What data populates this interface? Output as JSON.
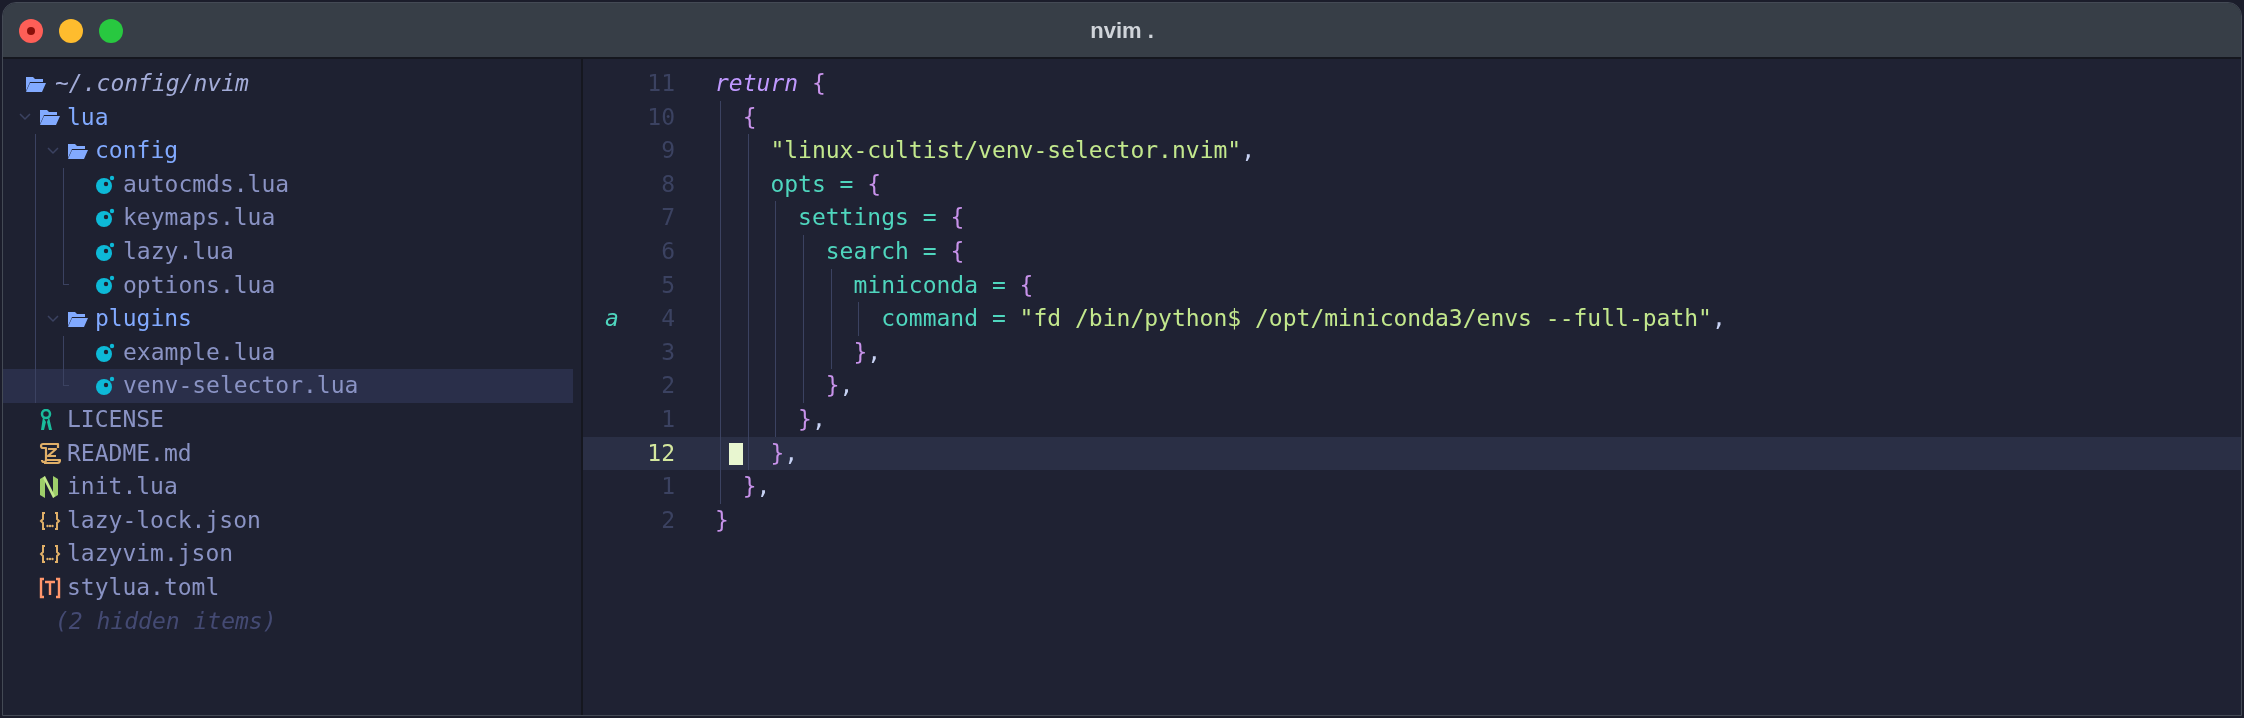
{
  "window": {
    "title": "nvim ."
  },
  "tree": {
    "root": "~/.config/nvim",
    "items": [
      {
        "kind": "folder",
        "name": "lua",
        "expanded": true,
        "selected": false,
        "children": [
          {
            "kind": "folder",
            "name": "config",
            "expanded": true,
            "selected": false,
            "children": [
              {
                "kind": "lua",
                "name": "autocmds.lua",
                "selected": false
              },
              {
                "kind": "lua",
                "name": "keymaps.lua",
                "selected": false
              },
              {
                "kind": "lua",
                "name": "lazy.lua",
                "selected": false
              },
              {
                "kind": "lua",
                "name": "options.lua",
                "selected": false
              }
            ]
          },
          {
            "kind": "folder",
            "name": "plugins",
            "expanded": true,
            "selected": false,
            "children": [
              {
                "kind": "lua",
                "name": "example.lua",
                "selected": false
              },
              {
                "kind": "lua",
                "name": "venv-selector.lua",
                "selected": true
              }
            ]
          }
        ]
      },
      {
        "kind": "license",
        "name": "LICENSE",
        "selected": false
      },
      {
        "kind": "markdown",
        "name": "README.md",
        "selected": false
      },
      {
        "kind": "neovim",
        "name": "init.lua",
        "selected": false
      },
      {
        "kind": "json",
        "name": "lazy-lock.json",
        "selected": false
      },
      {
        "kind": "json",
        "name": "lazyvim.json",
        "selected": false
      },
      {
        "kind": "toml",
        "name": "stylua.toml",
        "selected": false
      }
    ],
    "hidden_note": "(2 hidden items)"
  },
  "editor": {
    "lines": [
      {
        "number": "11",
        "current": false,
        "segments": [
          {
            "kind": "keyword",
            "text": "return"
          },
          {
            "kind": "punct",
            "text": " {"
          }
        ]
      },
      {
        "number": "10",
        "current": false,
        "segments": [
          {
            "kind": "punct",
            "text": "  {"
          }
        ]
      },
      {
        "number": "9",
        "current": false,
        "segments": [
          {
            "kind": "string",
            "text": "    \"linux-cultist/venv-selector.nvim\""
          },
          {
            "kind": "plain",
            "text": ","
          }
        ]
      },
      {
        "number": "8",
        "current": false,
        "segments": [
          {
            "kind": "field",
            "text": "    opts = "
          },
          {
            "kind": "punct",
            "text": "{"
          }
        ]
      },
      {
        "number": "7",
        "current": false,
        "segments": [
          {
            "kind": "field",
            "text": "      settings = "
          },
          {
            "kind": "punct",
            "text": "{"
          }
        ]
      },
      {
        "number": "6",
        "current": false,
        "segments": [
          {
            "kind": "field",
            "text": "        search = "
          },
          {
            "kind": "punct",
            "text": "{"
          }
        ]
      },
      {
        "number": "5",
        "current": false,
        "segments": [
          {
            "kind": "field",
            "text": "          miniconda = "
          },
          {
            "kind": "punct",
            "text": "{"
          }
        ]
      },
      {
        "number": "4",
        "sign": "a",
        "current": false,
        "segments": [
          {
            "kind": "field",
            "text": "            command = "
          },
          {
            "kind": "string",
            "text": "\"fd /bin/python$ /opt/miniconda3/envs --full-path\""
          },
          {
            "kind": "plain",
            "text": ","
          }
        ]
      },
      {
        "number": "3",
        "current": false,
        "segments": [
          {
            "kind": "punct",
            "text": "          }"
          },
          {
            "kind": "plain",
            "text": ","
          }
        ]
      },
      {
        "number": "2",
        "current": false,
        "segments": [
          {
            "kind": "punct",
            "text": "        }"
          },
          {
            "kind": "plain",
            "text": ","
          }
        ]
      },
      {
        "number": "1",
        "current": false,
        "segments": [
          {
            "kind": "punct",
            "text": "      }"
          },
          {
            "kind": "plain",
            "text": ","
          }
        ]
      },
      {
        "number": "12",
        "current": true,
        "segments": [
          {
            "kind": "punct",
            "text": "    }"
          },
          {
            "kind": "plain",
            "text": ","
          }
        ]
      },
      {
        "number": "1",
        "current": false,
        "segments": [
          {
            "kind": "punct",
            "text": "  }"
          },
          {
            "kind": "plain",
            "text": ","
          }
        ]
      },
      {
        "number": "2",
        "current": false,
        "segments": [
          {
            "kind": "punct",
            "text": "}"
          }
        ]
      }
    ]
  }
}
